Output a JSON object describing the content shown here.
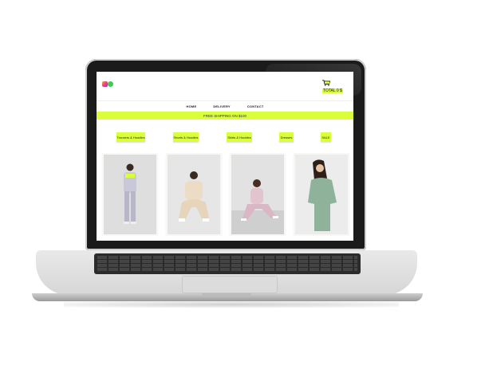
{
  "header": {
    "cart_total": "TOTAL 0 $"
  },
  "nav": {
    "items": [
      "HOME",
      "DELIVERY",
      "CONTACT"
    ]
  },
  "banner": {
    "text": "FREE SHIPPING ON $100"
  },
  "categories": [
    "Trousers & Hoodies",
    "Shorts & Hoodies",
    "Skirts & Hoodies",
    "Dresses",
    "SALE"
  ],
  "icons": {
    "instagram": "instagram-icon",
    "whatsapp": "whatsapp-icon",
    "cart": "shopping-cart-icon"
  },
  "colors": {
    "accent": "#d8ff3a",
    "instagram": "#e8467c",
    "whatsapp": "#3ccd4f"
  }
}
